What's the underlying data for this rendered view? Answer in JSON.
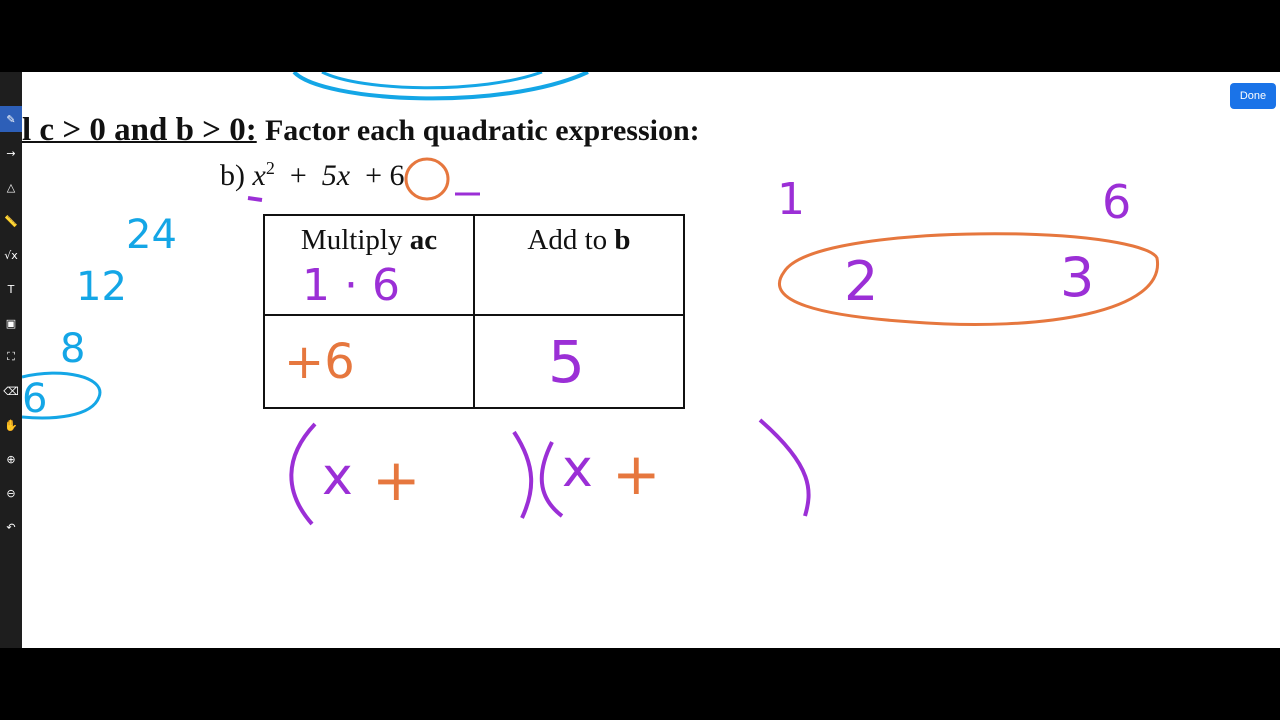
{
  "toolbar": {
    "tools": [
      {
        "name": "pen-tool",
        "glyph": "✎"
      },
      {
        "name": "arrow-tool",
        "glyph": "→"
      },
      {
        "name": "shapes-tool",
        "glyph": "△"
      },
      {
        "name": "ruler-tool",
        "glyph": "📏"
      },
      {
        "name": "math-tool",
        "glyph": "√x"
      },
      {
        "name": "text-tool",
        "glyph": "T"
      },
      {
        "name": "image-tool",
        "glyph": "▣"
      },
      {
        "name": "select-tool",
        "glyph": "⛶"
      },
      {
        "name": "eraser-tool",
        "glyph": "⌫"
      },
      {
        "name": "hand-tool",
        "glyph": "✋"
      },
      {
        "name": "zoom-in-tool",
        "glyph": "⊕"
      },
      {
        "name": "zoom-out-tool",
        "glyph": "⊖"
      },
      {
        "name": "undo-tool",
        "glyph": "↶"
      }
    ]
  },
  "done_label": "Done",
  "worksheet": {
    "heading_prefix": "l c > 0 and b > 0:",
    "heading_rest": "Factor each quadratic expression:",
    "problem_label": "b)",
    "problem_x": "x",
    "problem_exp": "2",
    "problem_plus1": "+",
    "problem_5x": "5x",
    "problem_plus2": "+",
    "problem_6": "6",
    "table": {
      "col1_header_a": "Multiply ",
      "col1_header_b": "ac",
      "col2_header_a": "Add to ",
      "col2_header_b": "b"
    }
  },
  "annotations": {
    "ink_left_24": "24",
    "ink_left_12": "12",
    "ink_left_8": "8",
    "ink_left_6": "6",
    "ink_cell_1_6": "1 · 6",
    "ink_cell_plus6": "+6",
    "ink_cell_5": "5",
    "ink_paren_left": "(x +",
    "ink_paren_right": ")(x +",
    "ink_paren_close": ")",
    "ink_right_1": "1",
    "ink_right_6": "6",
    "ink_right_2": "2",
    "ink_right_3": "3"
  },
  "colors": {
    "purple": "#9b2fd6",
    "orange": "#e6773e",
    "blue": "#14a6e6",
    "done_blue": "#1a73e8"
  }
}
